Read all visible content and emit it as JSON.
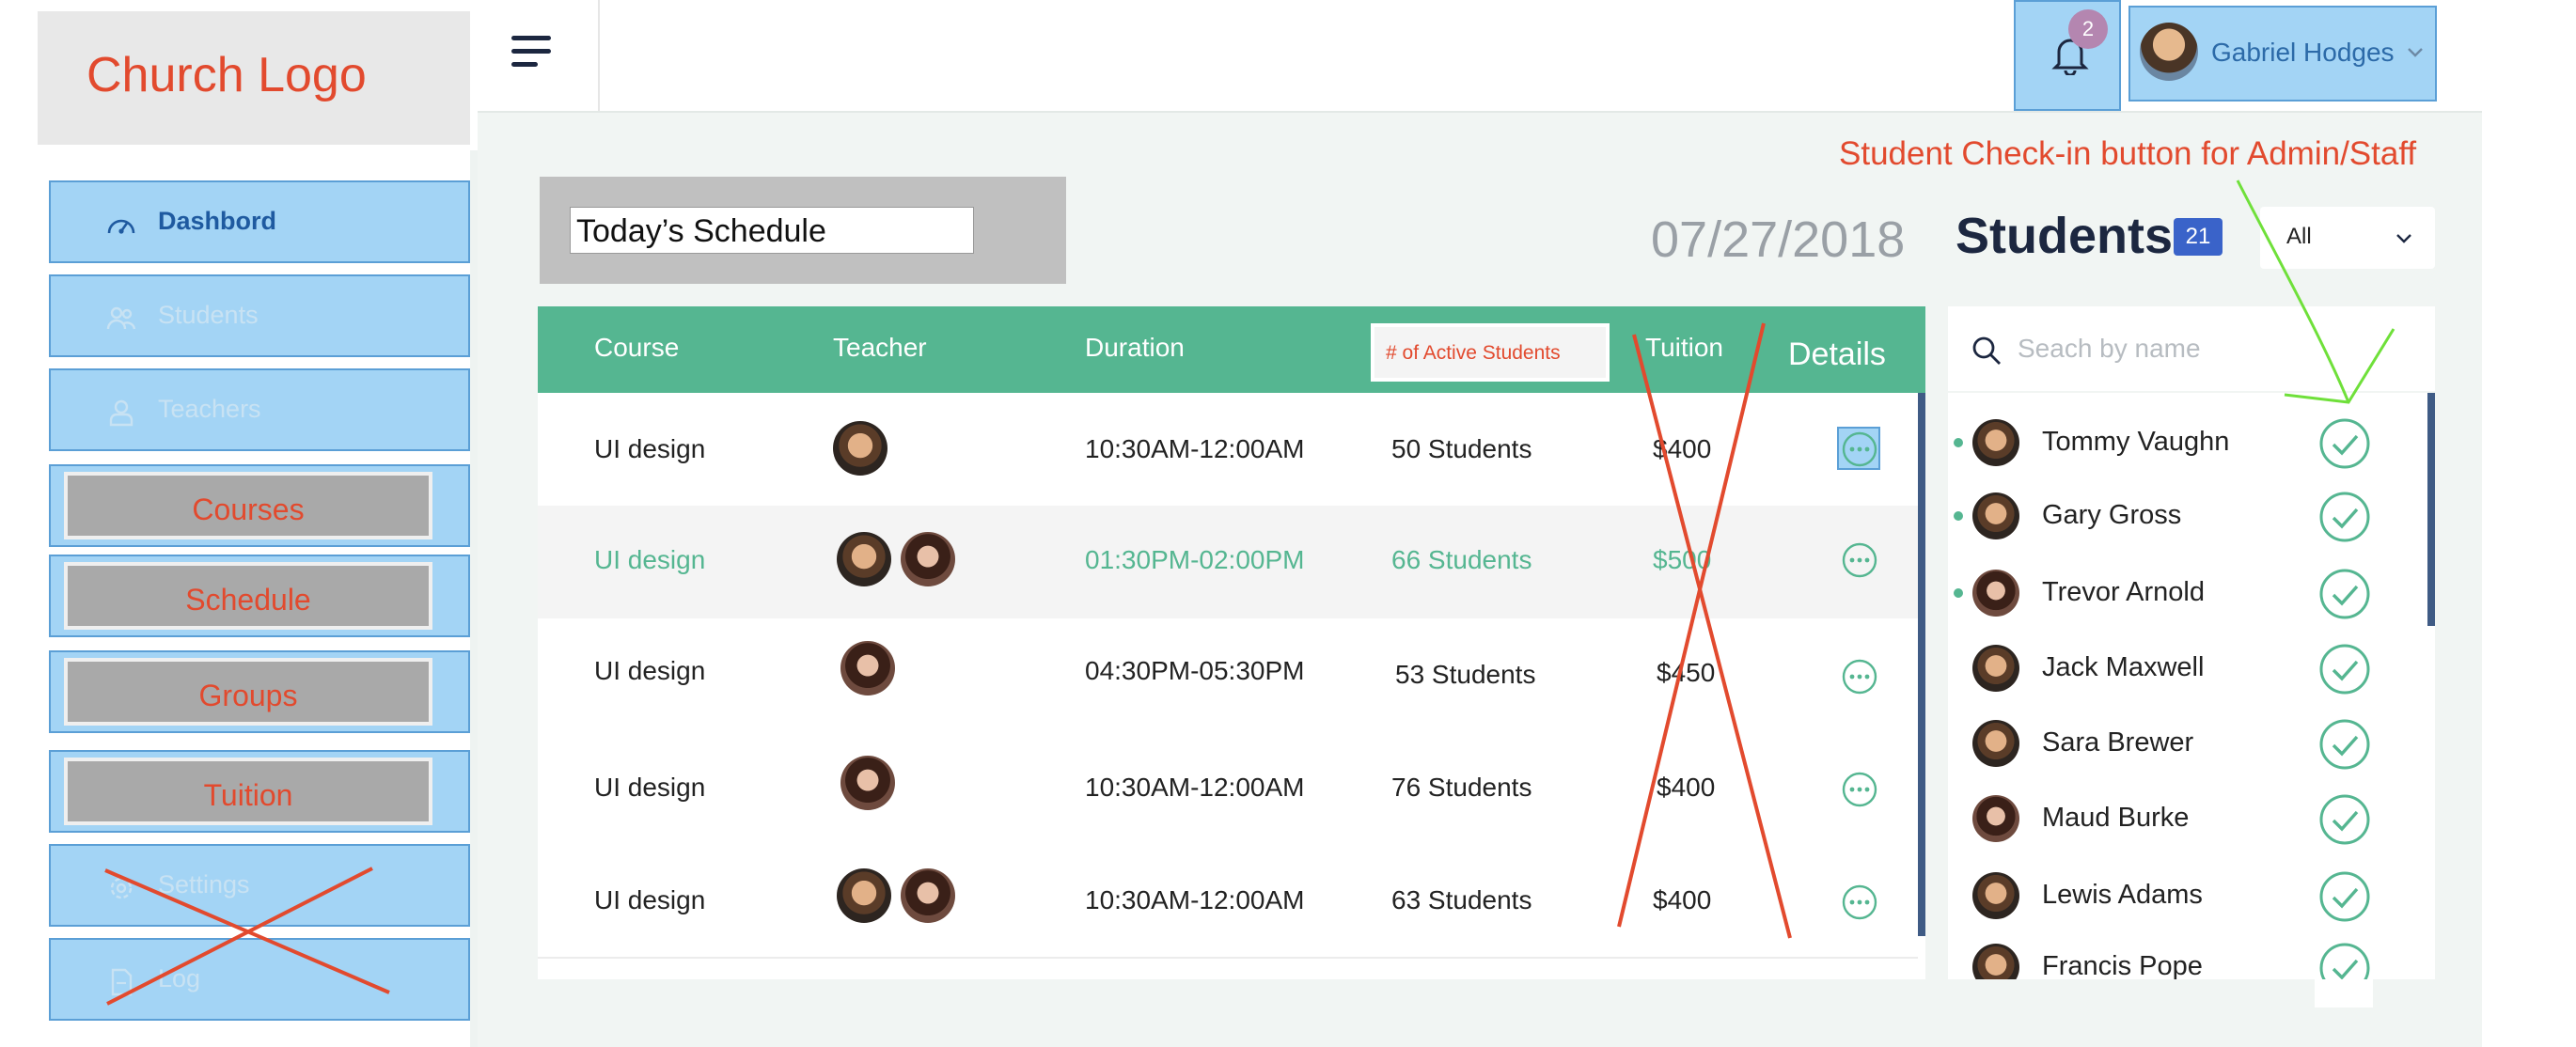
{
  "logo": {
    "text": "Church Logo"
  },
  "sidebar": {
    "items": [
      {
        "label": "Dashbord",
        "icon": "gauge-icon"
      },
      {
        "label": "Students",
        "icon": "users-icon"
      },
      {
        "label": "Teachers",
        "icon": "teacher-icon"
      },
      {
        "label": "Courses"
      },
      {
        "label": "Schedule"
      },
      {
        "label": "Groups"
      },
      {
        "label": "Tuition"
      },
      {
        "label": "Settings",
        "icon": "gear-icon"
      },
      {
        "label": "Log",
        "icon": "document-icon"
      }
    ]
  },
  "header": {
    "menu_icon": "hamburger-icon",
    "notifications": {
      "count": "2",
      "icon": "bell-icon"
    },
    "user": {
      "name": "Gabriel Hodges"
    }
  },
  "schedule": {
    "title": "Today’s Schedule",
    "date": "07/27/2018",
    "columns": [
      "Course",
      "Teacher",
      "Duration",
      "# of Active Students",
      "Tuition",
      "Details"
    ],
    "rows": [
      {
        "course": "UI design",
        "duration": "10:30AM-12:00AM",
        "students": "50 Students",
        "tuition": "$400",
        "teachers": [
          "male"
        ]
      },
      {
        "course": "UI design",
        "duration": "01:30PM-02:00PM",
        "students": "66 Students",
        "tuition": "$500",
        "teachers": [
          "male",
          "female"
        ]
      },
      {
        "course": "UI design",
        "duration": "04:30PM-05:30PM",
        "students": "53 Students",
        "tuition": "$450",
        "teachers": [
          "female"
        ]
      },
      {
        "course": "UI design",
        "duration": "10:30AM-12:00AM",
        "students": "76 Students",
        "tuition": "$400",
        "teachers": [
          "female"
        ]
      },
      {
        "course": "UI design",
        "duration": "10:30AM-12:00AM",
        "students": "63 Students",
        "tuition": "$400",
        "teachers": [
          "male",
          "female"
        ]
      }
    ]
  },
  "students": {
    "title": "Students",
    "count": "21",
    "filter": "All",
    "search_placeholder": "Seach by name",
    "list": [
      {
        "name": "Tommy Vaughn",
        "online": true
      },
      {
        "name": "Gary Gross",
        "online": true
      },
      {
        "name": "Trevor Arnold",
        "online": true
      },
      {
        "name": "Jack Maxwell",
        "online": false
      },
      {
        "name": "Sara Brewer",
        "online": false
      },
      {
        "name": "Maud Burke",
        "online": false
      },
      {
        "name": "Lewis Adams",
        "online": false
      },
      {
        "name": "Francis Pope",
        "online": false
      }
    ]
  },
  "annotations": {
    "checkin_note": "Student Check-in button for Admin/Staff"
  },
  "colors": {
    "accent_green": "#55b691",
    "annotation_red": "#e24a2e",
    "annotation_green": "#6fe03a",
    "highlight_blue": "#a3d4f5",
    "badge_blue": "#3a63c9",
    "dark_navy": "#1c2740"
  }
}
